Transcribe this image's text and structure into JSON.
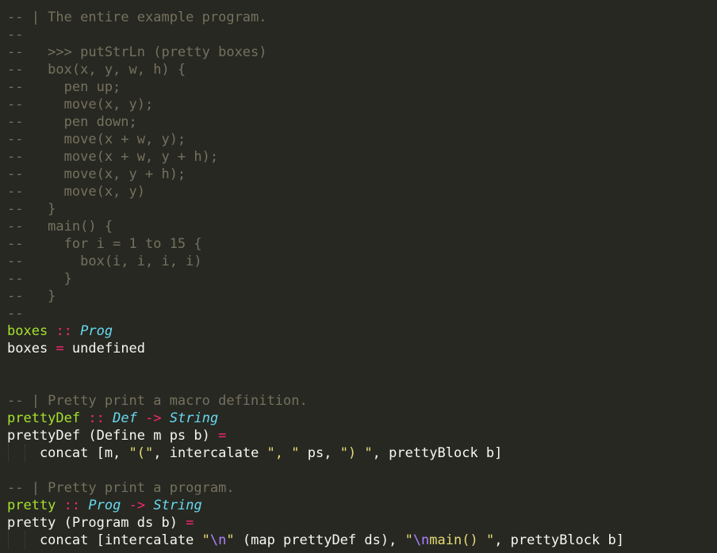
{
  "editor": {
    "theme_colors": {
      "background": "#272822",
      "comment": "#75715e",
      "function_name": "#a6e22e",
      "operator": "#f92672",
      "type": "#66d9ef",
      "string": "#e6db74",
      "escape": "#ae81ff",
      "plain": "#f8f8f2"
    },
    "lines": [
      {
        "tokens": [
          {
            "t": "comment",
            "v": "-- | The entire example program."
          }
        ]
      },
      {
        "tokens": [
          {
            "t": "comment",
            "v": "--"
          }
        ]
      },
      {
        "tokens": [
          {
            "t": "comment",
            "v": "--   >>> putStrLn (pretty boxes)"
          }
        ]
      },
      {
        "tokens": [
          {
            "t": "comment",
            "v": "--   box(x, y, w, h) {"
          }
        ]
      },
      {
        "tokens": [
          {
            "t": "comment",
            "v": "--     pen up;"
          }
        ]
      },
      {
        "tokens": [
          {
            "t": "comment",
            "v": "--     move(x, y);"
          }
        ]
      },
      {
        "tokens": [
          {
            "t": "comment",
            "v": "--     pen down;"
          }
        ]
      },
      {
        "tokens": [
          {
            "t": "comment",
            "v": "--     move(x + w, y);"
          }
        ]
      },
      {
        "tokens": [
          {
            "t": "comment",
            "v": "--     move(x + w, y + h);"
          }
        ]
      },
      {
        "tokens": [
          {
            "t": "comment",
            "v": "--     move(x, y + h);"
          }
        ]
      },
      {
        "tokens": [
          {
            "t": "comment",
            "v": "--     move(x, y)"
          }
        ]
      },
      {
        "tokens": [
          {
            "t": "comment",
            "v": "--   }"
          }
        ]
      },
      {
        "tokens": [
          {
            "t": "comment",
            "v": "--   main() {"
          }
        ]
      },
      {
        "tokens": [
          {
            "t": "comment",
            "v": "--     for i = 1 to 15 {"
          }
        ]
      },
      {
        "tokens": [
          {
            "t": "comment",
            "v": "--       box(i, i, i, i)"
          }
        ]
      },
      {
        "tokens": [
          {
            "t": "comment",
            "v": "--     }"
          }
        ]
      },
      {
        "tokens": [
          {
            "t": "comment",
            "v": "--   }"
          }
        ]
      },
      {
        "tokens": [
          {
            "t": "comment",
            "v": "--"
          }
        ]
      },
      {
        "tokens": [
          {
            "t": "fn",
            "v": "boxes"
          },
          {
            "t": "plain",
            "v": " "
          },
          {
            "t": "op",
            "v": "::"
          },
          {
            "t": "plain",
            "v": " "
          },
          {
            "t": "type",
            "v": "Prog"
          }
        ]
      },
      {
        "tokens": [
          {
            "t": "plain",
            "v": "boxes "
          },
          {
            "t": "op",
            "v": "="
          },
          {
            "t": "plain",
            "v": " undefined"
          }
        ]
      },
      {
        "tokens": []
      },
      {
        "tokens": []
      },
      {
        "tokens": [
          {
            "t": "comment",
            "v": "-- | Pretty print a macro definition."
          }
        ]
      },
      {
        "tokens": [
          {
            "t": "fn",
            "v": "prettyDef"
          },
          {
            "t": "plain",
            "v": " "
          },
          {
            "t": "op",
            "v": "::"
          },
          {
            "t": "plain",
            "v": " "
          },
          {
            "t": "type",
            "v": "Def"
          },
          {
            "t": "plain",
            "v": " "
          },
          {
            "t": "op",
            "v": "->"
          },
          {
            "t": "plain",
            "v": " "
          },
          {
            "t": "type",
            "v": "String"
          }
        ]
      },
      {
        "tokens": [
          {
            "t": "plain",
            "v": "prettyDef (Define m ps b) "
          },
          {
            "t": "op",
            "v": "="
          }
        ]
      },
      {
        "guides": true,
        "tokens": [
          {
            "t": "plain",
            "v": "    concat [m, "
          },
          {
            "t": "str",
            "v": "\"(\""
          },
          {
            "t": "plain",
            "v": ", intercalate "
          },
          {
            "t": "str",
            "v": "\", \""
          },
          {
            "t": "plain",
            "v": " ps, "
          },
          {
            "t": "str",
            "v": "\") \""
          },
          {
            "t": "plain",
            "v": ", prettyBlock b]"
          }
        ]
      },
      {
        "tokens": []
      },
      {
        "tokens": [
          {
            "t": "comment",
            "v": "-- | Pretty print a program."
          }
        ]
      },
      {
        "tokens": [
          {
            "t": "fn",
            "v": "pretty"
          },
          {
            "t": "plain",
            "v": " "
          },
          {
            "t": "op",
            "v": "::"
          },
          {
            "t": "plain",
            "v": " "
          },
          {
            "t": "type",
            "v": "Prog"
          },
          {
            "t": "plain",
            "v": " "
          },
          {
            "t": "op",
            "v": "->"
          },
          {
            "t": "plain",
            "v": " "
          },
          {
            "t": "type",
            "v": "String"
          }
        ]
      },
      {
        "tokens": [
          {
            "t": "plain",
            "v": "pretty (Program ds b) "
          },
          {
            "t": "op",
            "v": "="
          }
        ]
      },
      {
        "guides": true,
        "tokens": [
          {
            "t": "plain",
            "v": "    concat [intercalate "
          },
          {
            "t": "str",
            "v": "\""
          },
          {
            "t": "esc",
            "v": "\\n"
          },
          {
            "t": "str",
            "v": "\""
          },
          {
            "t": "plain",
            "v": " (map prettyDef ds), "
          },
          {
            "t": "str",
            "v": "\""
          },
          {
            "t": "esc",
            "v": "\\n"
          },
          {
            "t": "str",
            "v": "main() \""
          },
          {
            "t": "plain",
            "v": ", prettyBlock b]"
          }
        ]
      }
    ]
  }
}
